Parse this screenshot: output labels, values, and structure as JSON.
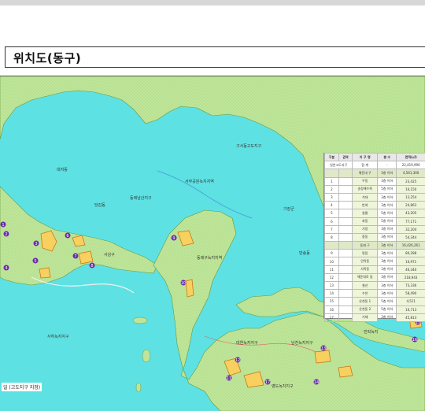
{
  "page": {
    "title": "위치도(동구)",
    "caption": "일 (고도지구 지정)"
  },
  "colors": {
    "sea": "#5ee1e3",
    "land": "#bfe59a",
    "land_dots": "#a5d879",
    "zone": "#f7d060",
    "zone_border": "#c87a1a",
    "marker": "#6a2ca6",
    "legend_fill": "#eef5da"
  },
  "legend": {
    "headers": [
      "구분",
      "권역",
      "지 구 명",
      "층 수",
      "면적(㎡)",
      ""
    ],
    "total_label": "합 계",
    "total_value": "22,419,990",
    "rows": [
      {
        "no": "",
        "name": "해운대 구",
        "floors": "3층 이하",
        "area": "4,561,300",
        "sub": true
      },
      {
        "no": "1",
        "name": "우동",
        "floors": "3층 이하",
        "area": "23,425",
        "sub": false
      },
      {
        "no": "2",
        "name": "송정해수욕",
        "floors": "5층 이하",
        "area": "16,150",
        "sub": false
      },
      {
        "no": "3",
        "name": "석대",
        "floors": "3층 이하",
        "area": "12,254",
        "sub": false
      },
      {
        "no": "4",
        "name": "반여",
        "floors": "3층 이하",
        "area": "24,863",
        "sub": false
      },
      {
        "no": "5",
        "name": "청룡",
        "floors": "5층 이하",
        "area": "43,205",
        "sub": false
      },
      {
        "no": "6",
        "name": "좌동",
        "floors": "5층 이하",
        "area": "77,171",
        "sub": false
      },
      {
        "no": "7",
        "name": "기장",
        "floors": "3층 이하",
        "area": "32,204",
        "sub": false
      },
      {
        "no": "8",
        "name": "중동",
        "floors": "3층 이하",
        "area": "54,344",
        "sub": false
      },
      {
        "no": "",
        "name": "동래 구",
        "floors": "3층 이하",
        "area": "16,426,261",
        "sub": true
      },
      {
        "no": "9",
        "name": "명장",
        "floors": "3층 이하",
        "area": "80,288",
        "sub": false
      },
      {
        "no": "10",
        "name": "안락동",
        "floors": "3층 이하",
        "area": "16,971",
        "sub": false
      },
      {
        "no": "11",
        "name": "사직동",
        "floors": "3층 이하",
        "area": "46,340",
        "sub": false
      },
      {
        "no": "12",
        "name": "해운대로 일",
        "floors": "3층 이하",
        "area": "218,943",
        "sub": false
      },
      {
        "no": "13",
        "name": "칠산",
        "floors": "3층 이하",
        "area": "73,336",
        "sub": false
      },
      {
        "no": "14",
        "name": "수안",
        "floors": "3층 이하",
        "area": "58,490",
        "sub": false
      },
      {
        "no": "15",
        "name": "온천동 1",
        "floors": "5층 이하",
        "area": "4,511",
        "sub": false
      },
      {
        "no": "16",
        "name": "온천동 2",
        "floors": "5층 이하",
        "area": "16,713",
        "sub": false
      },
      {
        "no": "17",
        "name": "거제",
        "floors": "3층 이하",
        "area": "45,813",
        "sub": false
      }
    ],
    "side_label": "일반고도지구"
  },
  "map_labels": [
    {
      "text": "대저동"
    },
    {
      "text": "서부공원녹지지역"
    },
    {
      "text": "동래남산지구"
    },
    {
      "text": "당감동"
    },
    {
      "text": "구서동고도지구"
    },
    {
      "text": "기장군"
    },
    {
      "text": "반송동"
    },
    {
      "text": "동래구녹지지역"
    },
    {
      "text": "대연녹지지구"
    },
    {
      "text": "사하녹지지구"
    },
    {
      "text": "남천녹지지구"
    },
    {
      "text": "민락녹지"
    },
    {
      "text": "영도녹지지구"
    },
    {
      "text": "사상구"
    }
  ],
  "markers": [
    "1",
    "2",
    "3",
    "4",
    "5",
    "6",
    "7",
    "8",
    "9",
    "10",
    "11",
    "12",
    "13",
    "14",
    "15",
    "16",
    "17"
  ]
}
